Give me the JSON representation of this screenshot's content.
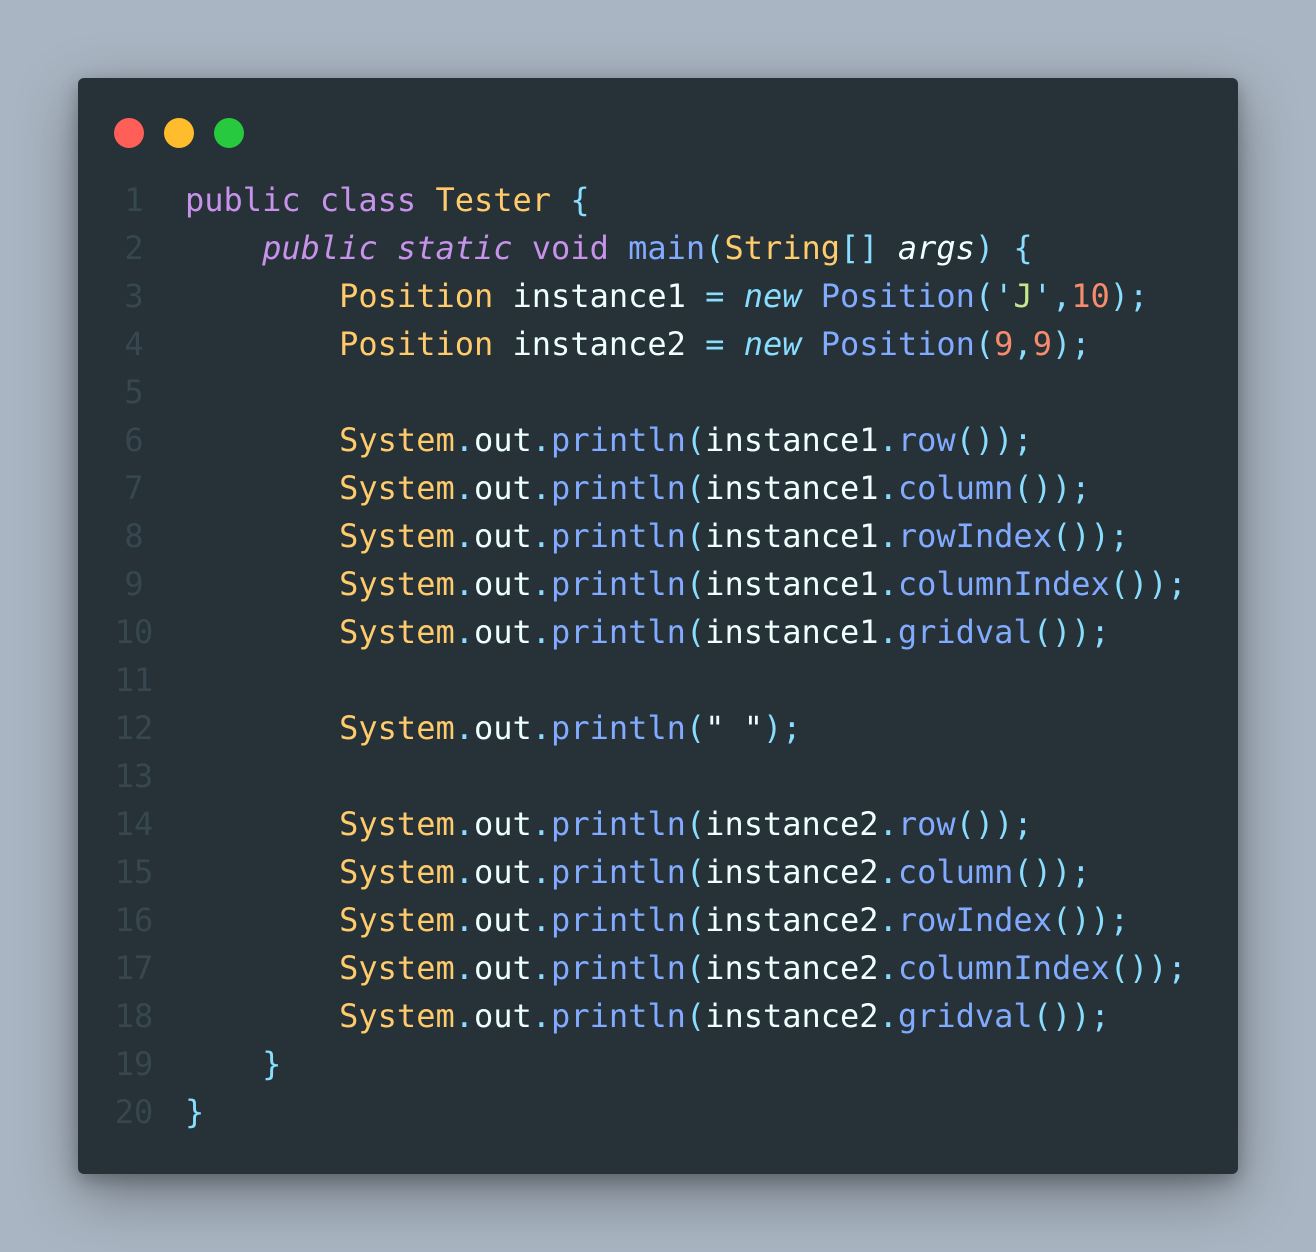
{
  "window": {
    "controls": [
      {
        "name": "close",
        "color": "#ff5f56"
      },
      {
        "name": "minimize",
        "color": "#ffbd2e"
      },
      {
        "name": "maximize",
        "color": "#27c93f"
      }
    ]
  },
  "code": {
    "language": "java",
    "lines": [
      {
        "number": "1",
        "tokens": [
          {
            "t": "public",
            "c": "kw"
          },
          {
            "t": " ",
            "c": "var"
          },
          {
            "t": "class",
            "c": "kw"
          },
          {
            "t": " ",
            "c": "var"
          },
          {
            "t": "Tester",
            "c": "type"
          },
          {
            "t": " ",
            "c": "var"
          },
          {
            "t": "{",
            "c": "punc"
          }
        ]
      },
      {
        "number": "2",
        "tokens": [
          {
            "t": "    ",
            "c": "var"
          },
          {
            "t": "public",
            "c": "kwi"
          },
          {
            "t": " ",
            "c": "var"
          },
          {
            "t": "static",
            "c": "kwi"
          },
          {
            "t": " ",
            "c": "var"
          },
          {
            "t": "void",
            "c": "kw"
          },
          {
            "t": " ",
            "c": "var"
          },
          {
            "t": "main",
            "c": "fn"
          },
          {
            "t": "(",
            "c": "punc"
          },
          {
            "t": "String",
            "c": "type"
          },
          {
            "t": "[]",
            "c": "punc"
          },
          {
            "t": " ",
            "c": "var"
          },
          {
            "t": "args",
            "c": "argi"
          },
          {
            "t": ")",
            "c": "punc"
          },
          {
            "t": " ",
            "c": "var"
          },
          {
            "t": "{",
            "c": "punc"
          }
        ]
      },
      {
        "number": "3",
        "tokens": [
          {
            "t": "        ",
            "c": "var"
          },
          {
            "t": "Position",
            "c": "type"
          },
          {
            "t": " instance1 ",
            "c": "var"
          },
          {
            "t": "=",
            "c": "op"
          },
          {
            "t": " ",
            "c": "var"
          },
          {
            "t": "new",
            "c": "newi"
          },
          {
            "t": " ",
            "c": "var"
          },
          {
            "t": "Position",
            "c": "fn"
          },
          {
            "t": "(",
            "c": "punc"
          },
          {
            "t": "'",
            "c": "punc"
          },
          {
            "t": "J",
            "c": "str"
          },
          {
            "t": "'",
            "c": "punc"
          },
          {
            "t": ",",
            "c": "punc"
          },
          {
            "t": "10",
            "c": "num"
          },
          {
            "t": ");",
            "c": "punc"
          }
        ]
      },
      {
        "number": "4",
        "tokens": [
          {
            "t": "        ",
            "c": "var"
          },
          {
            "t": "Position",
            "c": "type"
          },
          {
            "t": " instance2 ",
            "c": "var"
          },
          {
            "t": "=",
            "c": "op"
          },
          {
            "t": " ",
            "c": "var"
          },
          {
            "t": "new",
            "c": "newi"
          },
          {
            "t": " ",
            "c": "var"
          },
          {
            "t": "Position",
            "c": "fn"
          },
          {
            "t": "(",
            "c": "punc"
          },
          {
            "t": "9",
            "c": "num"
          },
          {
            "t": ",",
            "c": "punc"
          },
          {
            "t": "9",
            "c": "num"
          },
          {
            "t": ");",
            "c": "punc"
          }
        ]
      },
      {
        "number": "5",
        "tokens": []
      },
      {
        "number": "6",
        "tokens": [
          {
            "t": "        ",
            "c": "var"
          },
          {
            "t": "System",
            "c": "type"
          },
          {
            "t": ".",
            "c": "punc"
          },
          {
            "t": "out",
            "c": "var"
          },
          {
            "t": ".",
            "c": "punc"
          },
          {
            "t": "println",
            "c": "fn"
          },
          {
            "t": "(",
            "c": "punc"
          },
          {
            "t": "instance1",
            "c": "var"
          },
          {
            "t": ".",
            "c": "punc"
          },
          {
            "t": "row",
            "c": "fn"
          },
          {
            "t": "());",
            "c": "punc"
          }
        ]
      },
      {
        "number": "7",
        "tokens": [
          {
            "t": "        ",
            "c": "var"
          },
          {
            "t": "System",
            "c": "type"
          },
          {
            "t": ".",
            "c": "punc"
          },
          {
            "t": "out",
            "c": "var"
          },
          {
            "t": ".",
            "c": "punc"
          },
          {
            "t": "println",
            "c": "fn"
          },
          {
            "t": "(",
            "c": "punc"
          },
          {
            "t": "instance1",
            "c": "var"
          },
          {
            "t": ".",
            "c": "punc"
          },
          {
            "t": "column",
            "c": "fn"
          },
          {
            "t": "());",
            "c": "punc"
          }
        ]
      },
      {
        "number": "8",
        "tokens": [
          {
            "t": "        ",
            "c": "var"
          },
          {
            "t": "System",
            "c": "type"
          },
          {
            "t": ".",
            "c": "punc"
          },
          {
            "t": "out",
            "c": "var"
          },
          {
            "t": ".",
            "c": "punc"
          },
          {
            "t": "println",
            "c": "fn"
          },
          {
            "t": "(",
            "c": "punc"
          },
          {
            "t": "instance1",
            "c": "var"
          },
          {
            "t": ".",
            "c": "punc"
          },
          {
            "t": "rowIndex",
            "c": "fn"
          },
          {
            "t": "());",
            "c": "punc"
          }
        ]
      },
      {
        "number": "9",
        "tokens": [
          {
            "t": "        ",
            "c": "var"
          },
          {
            "t": "System",
            "c": "type"
          },
          {
            "t": ".",
            "c": "punc"
          },
          {
            "t": "out",
            "c": "var"
          },
          {
            "t": ".",
            "c": "punc"
          },
          {
            "t": "println",
            "c": "fn"
          },
          {
            "t": "(",
            "c": "punc"
          },
          {
            "t": "instance1",
            "c": "var"
          },
          {
            "t": ".",
            "c": "punc"
          },
          {
            "t": "columnIndex",
            "c": "fn"
          },
          {
            "t": "());",
            "c": "punc"
          }
        ]
      },
      {
        "number": "10",
        "tokens": [
          {
            "t": "        ",
            "c": "var"
          },
          {
            "t": "System",
            "c": "type"
          },
          {
            "t": ".",
            "c": "punc"
          },
          {
            "t": "out",
            "c": "var"
          },
          {
            "t": ".",
            "c": "punc"
          },
          {
            "t": "println",
            "c": "fn"
          },
          {
            "t": "(",
            "c": "punc"
          },
          {
            "t": "instance1",
            "c": "var"
          },
          {
            "t": ".",
            "c": "punc"
          },
          {
            "t": "gridval",
            "c": "fn"
          },
          {
            "t": "());",
            "c": "punc"
          }
        ]
      },
      {
        "number": "11",
        "tokens": []
      },
      {
        "number": "12",
        "tokens": [
          {
            "t": "        ",
            "c": "var"
          },
          {
            "t": "System",
            "c": "type"
          },
          {
            "t": ".",
            "c": "punc"
          },
          {
            "t": "out",
            "c": "var"
          },
          {
            "t": ".",
            "c": "punc"
          },
          {
            "t": "println",
            "c": "fn"
          },
          {
            "t": "(",
            "c": "punc"
          },
          {
            "t": "\" \"",
            "c": "var"
          },
          {
            "t": ");",
            "c": "punc"
          }
        ]
      },
      {
        "number": "13",
        "tokens": []
      },
      {
        "number": "14",
        "tokens": [
          {
            "t": "        ",
            "c": "var"
          },
          {
            "t": "System",
            "c": "type"
          },
          {
            "t": ".",
            "c": "punc"
          },
          {
            "t": "out",
            "c": "var"
          },
          {
            "t": ".",
            "c": "punc"
          },
          {
            "t": "println",
            "c": "fn"
          },
          {
            "t": "(",
            "c": "punc"
          },
          {
            "t": "instance2",
            "c": "var"
          },
          {
            "t": ".",
            "c": "punc"
          },
          {
            "t": "row",
            "c": "fn"
          },
          {
            "t": "());",
            "c": "punc"
          }
        ]
      },
      {
        "number": "15",
        "tokens": [
          {
            "t": "        ",
            "c": "var"
          },
          {
            "t": "System",
            "c": "type"
          },
          {
            "t": ".",
            "c": "punc"
          },
          {
            "t": "out",
            "c": "var"
          },
          {
            "t": ".",
            "c": "punc"
          },
          {
            "t": "println",
            "c": "fn"
          },
          {
            "t": "(",
            "c": "punc"
          },
          {
            "t": "instance2",
            "c": "var"
          },
          {
            "t": ".",
            "c": "punc"
          },
          {
            "t": "column",
            "c": "fn"
          },
          {
            "t": "());",
            "c": "punc"
          }
        ]
      },
      {
        "number": "16",
        "tokens": [
          {
            "t": "        ",
            "c": "var"
          },
          {
            "t": "System",
            "c": "type"
          },
          {
            "t": ".",
            "c": "punc"
          },
          {
            "t": "out",
            "c": "var"
          },
          {
            "t": ".",
            "c": "punc"
          },
          {
            "t": "println",
            "c": "fn"
          },
          {
            "t": "(",
            "c": "punc"
          },
          {
            "t": "instance2",
            "c": "var"
          },
          {
            "t": ".",
            "c": "punc"
          },
          {
            "t": "rowIndex",
            "c": "fn"
          },
          {
            "t": "());",
            "c": "punc"
          }
        ]
      },
      {
        "number": "17",
        "tokens": [
          {
            "t": "        ",
            "c": "var"
          },
          {
            "t": "System",
            "c": "type"
          },
          {
            "t": ".",
            "c": "punc"
          },
          {
            "t": "out",
            "c": "var"
          },
          {
            "t": ".",
            "c": "punc"
          },
          {
            "t": "println",
            "c": "fn"
          },
          {
            "t": "(",
            "c": "punc"
          },
          {
            "t": "instance2",
            "c": "var"
          },
          {
            "t": ".",
            "c": "punc"
          },
          {
            "t": "columnIndex",
            "c": "fn"
          },
          {
            "t": "());",
            "c": "punc"
          }
        ]
      },
      {
        "number": "18",
        "tokens": [
          {
            "t": "        ",
            "c": "var"
          },
          {
            "t": "System",
            "c": "type"
          },
          {
            "t": ".",
            "c": "punc"
          },
          {
            "t": "out",
            "c": "var"
          },
          {
            "t": ".",
            "c": "punc"
          },
          {
            "t": "println",
            "c": "fn"
          },
          {
            "t": "(",
            "c": "punc"
          },
          {
            "t": "instance2",
            "c": "var"
          },
          {
            "t": ".",
            "c": "punc"
          },
          {
            "t": "gridval",
            "c": "fn"
          },
          {
            "t": "());",
            "c": "punc"
          }
        ]
      },
      {
        "number": "19",
        "tokens": [
          {
            "t": "    ",
            "c": "var"
          },
          {
            "t": "}",
            "c": "punc"
          }
        ]
      },
      {
        "number": "20",
        "tokens": [
          {
            "t": "}",
            "c": "punc"
          }
        ]
      }
    ]
  }
}
